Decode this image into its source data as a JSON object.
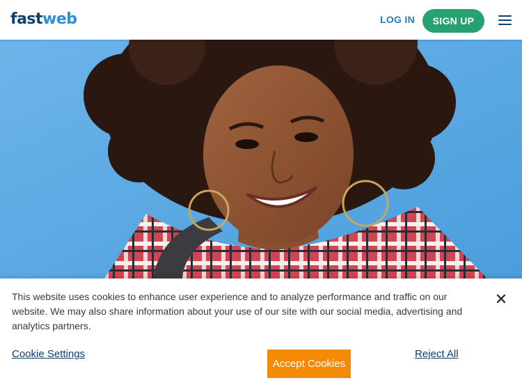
{
  "header": {
    "logo_part1": "fast",
    "logo_part2": "web",
    "login_label": "LOG IN",
    "signup_label": "SIGN UP",
    "menu_icon": "hamburger-menu-icon"
  },
  "hero": {
    "image": "smiling-student-photo",
    "background_color": "#5aa9e4"
  },
  "cookie_banner": {
    "message": "This website uses cookies to enhance user experience and to analyze performance and traffic on our website. We may also share information about your use of our site with our social media, advertising and analytics partners.",
    "settings_label": "Cookie Settings",
    "accept_label": "Accept Cookies",
    "reject_label": "Reject All",
    "close_icon": "close-icon"
  },
  "colors": {
    "brand_dark": "#0f3f6d",
    "brand_light": "#2f8fd6",
    "signup_green": "#27a172",
    "accept_orange": "#f58a07"
  }
}
